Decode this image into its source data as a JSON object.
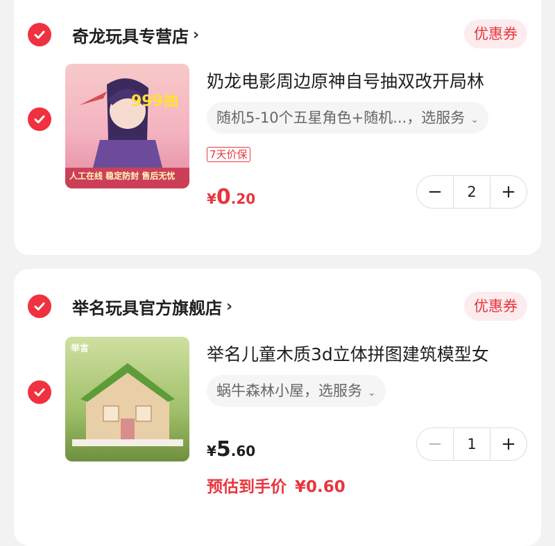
{
  "colors": {
    "accent": "#f0313f",
    "coupon_bg": "#fdeced",
    "page_bg": "#f2f2f2"
  },
  "carts": [
    {
      "store_name": "奇龙玩具专营店",
      "store_chevron": "›",
      "coupon_label": "优惠券",
      "title": "奶龙电影周边原神自号抽双改开局林",
      "variant": "随机5-10个五星角色+随机...，选服务",
      "variant_icon": "chevron-down-icon",
      "tag": "7天价保",
      "price": {
        "currency": "¥",
        "int": "0",
        "dec": ".20"
      },
      "qty": "2",
      "image_overlay": {
        "top_text": "999抽",
        "bottom_text": "人工在线 稳定防封 售后无忧"
      }
    },
    {
      "store_name": "举名玩具官方旗舰店",
      "store_chevron": "›",
      "coupon_label": "优惠券",
      "title": "举名儿童木质3d立体拼图建筑模型女",
      "variant": "蜗牛森林小屋，选服务",
      "variant_icon": "chevron-down-icon",
      "price": {
        "currency": "¥",
        "int": "5",
        "dec": ".60"
      },
      "qty": "1",
      "estimate_label": "预估到手价",
      "estimate_value": "¥0.60",
      "image_overlay": {
        "brand_text": "举言"
      }
    }
  ],
  "stepper": {
    "minus": "−",
    "plus": "+"
  }
}
